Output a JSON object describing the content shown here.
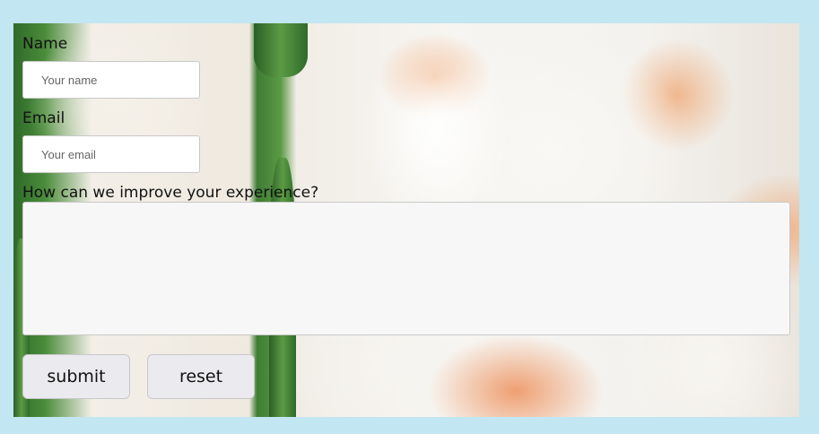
{
  "form": {
    "name_label": "Name",
    "name_placeholder": "Your name",
    "email_label": "Email",
    "email_placeholder": "Your email",
    "feedback_label": "How can we improve your experience?",
    "submit_label": "submit",
    "reset_label": "reset"
  },
  "colors": {
    "page_background": "#c2e6f2",
    "button_background": "#ebeaee",
    "textarea_background": "#f7f7f7"
  }
}
